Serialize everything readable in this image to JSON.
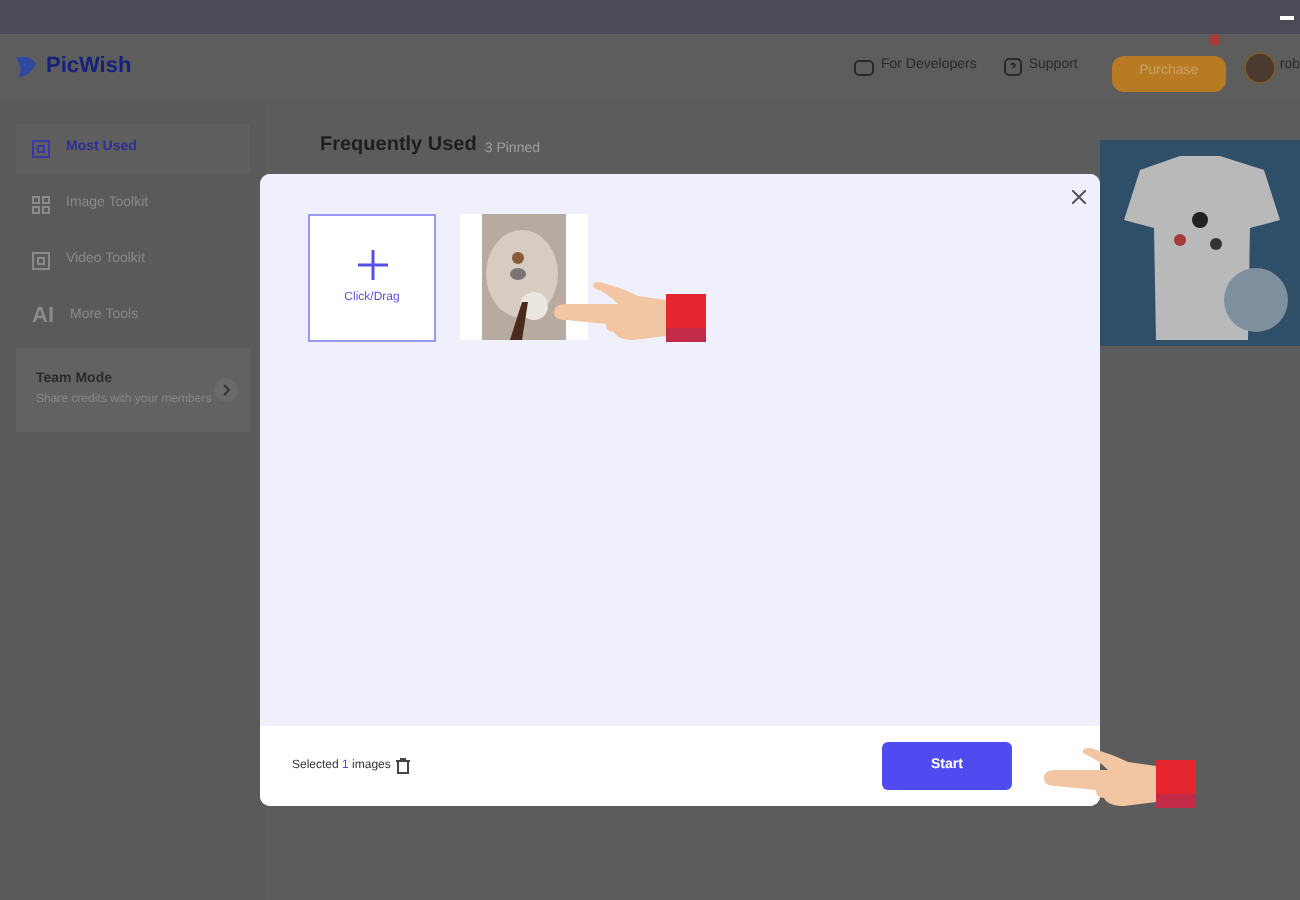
{
  "header": {
    "brand": "PicWish",
    "links": [
      "For Developers",
      "Support"
    ],
    "purchase": "Purchase",
    "user": "rob"
  },
  "sidebar": {
    "items": [
      {
        "label": "Most Used",
        "selected": true
      },
      {
        "label": "Image Toolkit",
        "selected": false
      },
      {
        "label": "Video Toolkit",
        "selected": false
      },
      {
        "label": "More Tools",
        "selected": false,
        "icon": "AI"
      }
    ],
    "team": {
      "title": "Team Mode",
      "text": "Share credits with your members"
    }
  },
  "main": {
    "title": "Frequently Used",
    "pinned": "3 Pinned"
  },
  "dialog": {
    "upload_label": "Click/Drag",
    "selected": {
      "prefix": "Selected",
      "count": "1",
      "suffix": "images"
    },
    "start": "Start"
  }
}
